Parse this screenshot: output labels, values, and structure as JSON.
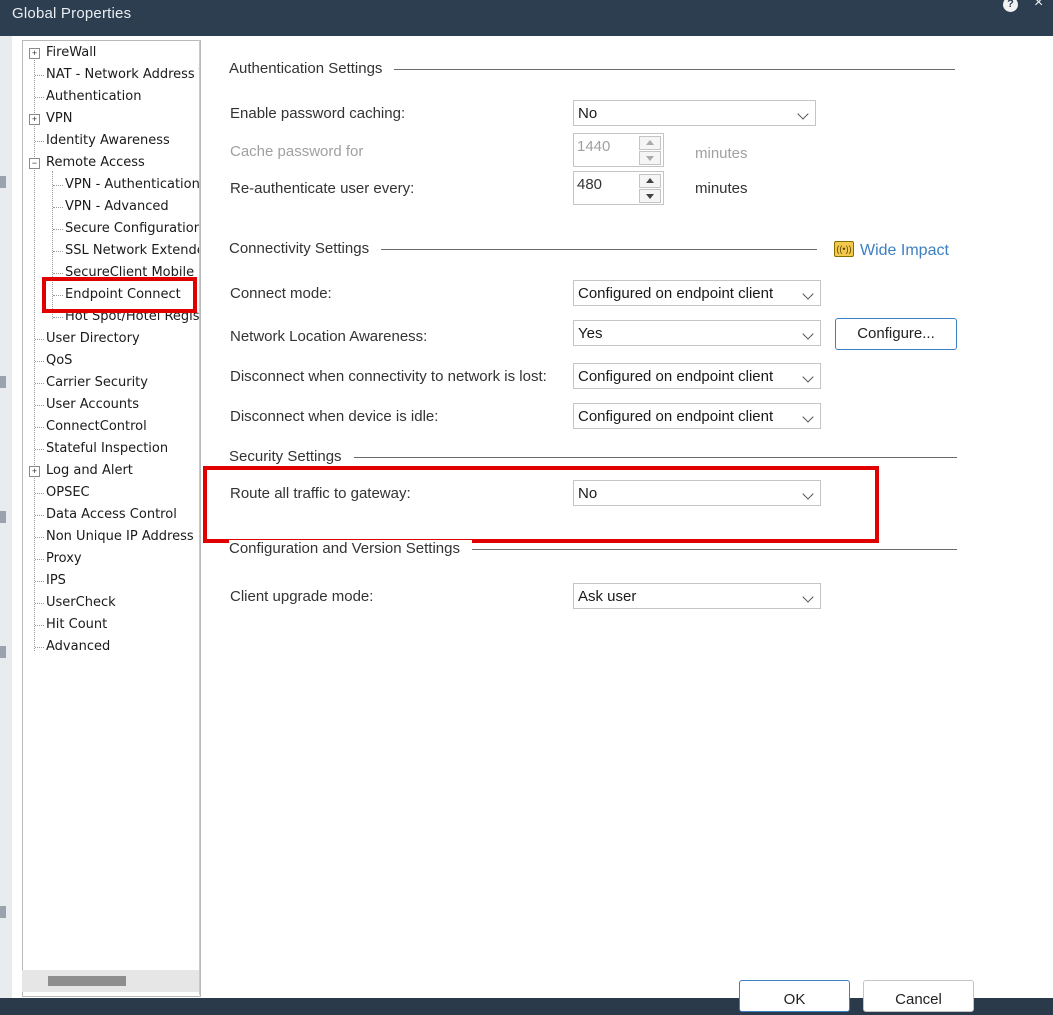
{
  "window": {
    "title": "Global Properties",
    "help": "?",
    "close": "×"
  },
  "tree": {
    "items": [
      {
        "label": "FireWall",
        "expander": "+"
      },
      {
        "label": "NAT - Network Address T"
      },
      {
        "label": "Authentication"
      },
      {
        "label": "VPN",
        "expander": "+"
      },
      {
        "label": "Identity Awareness"
      },
      {
        "label": "Remote Access",
        "expander": "−"
      },
      {
        "label": "VPN - Authentication"
      },
      {
        "label": "VPN - Advanced"
      },
      {
        "label": "Secure Configuration V"
      },
      {
        "label": "SSL Network Extender"
      },
      {
        "label": "SecureClient Mobile"
      },
      {
        "label": "Endpoint Connect",
        "selected": true
      },
      {
        "label": "Hot Spot/Hotel Regist"
      },
      {
        "label": "User Directory"
      },
      {
        "label": "QoS"
      },
      {
        "label": "Carrier Security"
      },
      {
        "label": "User Accounts"
      },
      {
        "label": "ConnectControl"
      },
      {
        "label": "Stateful Inspection"
      },
      {
        "label": "Log and Alert",
        "expander": "+"
      },
      {
        "label": "OPSEC"
      },
      {
        "label": "Data Access Control"
      },
      {
        "label": "Non Unique IP Address R"
      },
      {
        "label": "Proxy"
      },
      {
        "label": "IPS"
      },
      {
        "label": "UserCheck"
      },
      {
        "label": "Hit Count"
      },
      {
        "label": "Advanced"
      }
    ]
  },
  "auth": {
    "title": "Authentication Settings",
    "password_caching_label": "Enable password caching:",
    "password_caching_value": "No",
    "cache_for_label": "Cache password for",
    "cache_for_value": "1440",
    "cache_for_unit": "minutes",
    "reauth_label": "Re-authenticate user every:",
    "reauth_value": "480",
    "reauth_unit": "minutes"
  },
  "connectivity": {
    "title": "Connectivity Settings",
    "wide_impact": "Wide Impact",
    "connect_mode_label": "Connect mode:",
    "connect_mode_value": "Configured on endpoint client",
    "nla_label": "Network Location Awareness:",
    "nla_value": "Yes",
    "configure_button": "Configure...",
    "disconnect_lost_label": "Disconnect when connectivity to network is lost:",
    "disconnect_lost_value": "Configured on endpoint client",
    "disconnect_idle_label": "Disconnect when device is idle:",
    "disconnect_idle_value": "Configured on endpoint client"
  },
  "security": {
    "title": "Security Settings",
    "route_label": "Route all traffic to gateway:",
    "route_value": "No"
  },
  "config_version": {
    "title": "Configuration and Version Settings",
    "upgrade_label": "Client upgrade mode:",
    "upgrade_value": "Ask user"
  },
  "footer": {
    "ok": "OK",
    "cancel": "Cancel"
  },
  "colors": {
    "highlight": "#e00000",
    "link": "#3b7fc4",
    "titlebar": "#2d3e50"
  }
}
